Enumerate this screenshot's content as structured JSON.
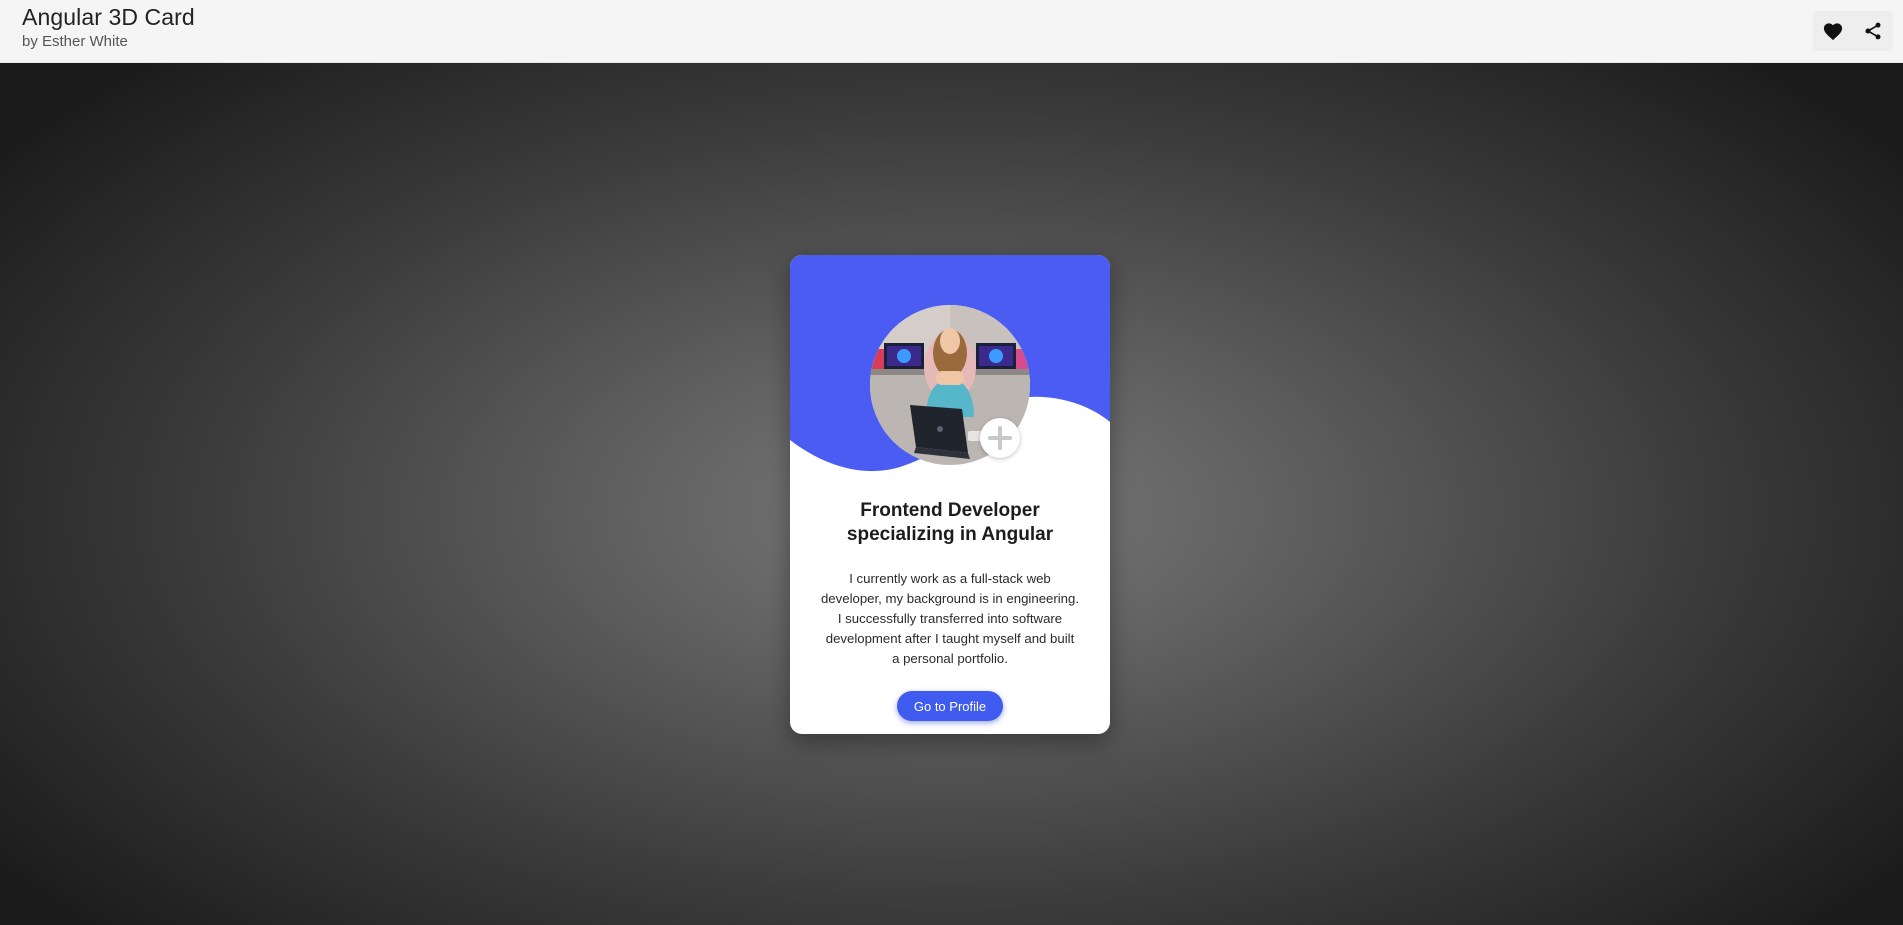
{
  "header": {
    "title": "Angular 3D Card",
    "byline": "by Esther White",
    "actions": [
      {
        "icon": "heart-icon",
        "label": "Like"
      },
      {
        "icon": "share-icon",
        "label": "Share"
      }
    ]
  },
  "card": {
    "headline_line1": "Frontend Developer",
    "headline_line2": "specializing in Angular",
    "bio_lines": [
      "I currently work as a full-stack web",
      "developer, my background is in engineering.",
      "I successfully transferred into software",
      "development after I taught myself and built",
      "a personal portfolio."
    ],
    "button_label": "Go to Profile",
    "add_icon": "plus-icon",
    "accent_color": "#4a5cf2",
    "button_color": "#3f5bf0"
  }
}
